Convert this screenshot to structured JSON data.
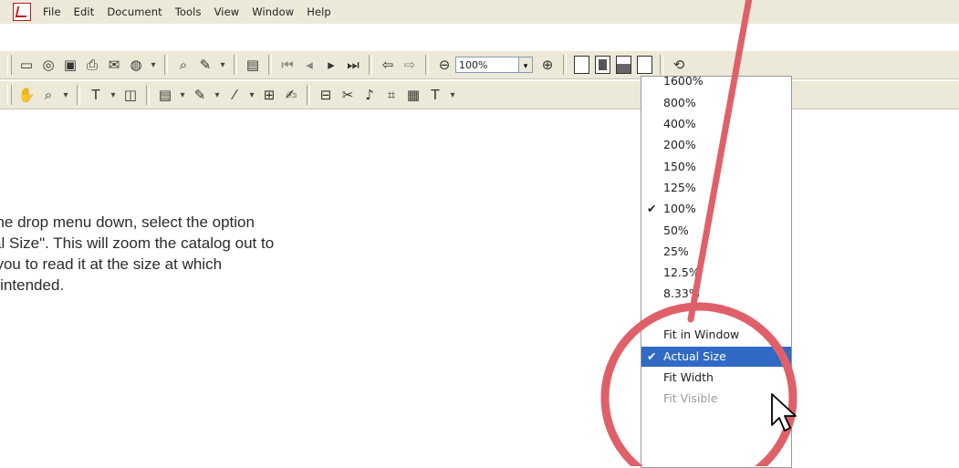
{
  "menubar": {
    "items": [
      "File",
      "Edit",
      "Document",
      "Tools",
      "View",
      "Window",
      "Help"
    ]
  },
  "toolbar": {
    "zoom_value": "100%"
  },
  "instruction": {
    "lines": [
      "With the drop menu down, select the option",
      "\"Actual Size\". This will zoom the catalog out to",
      "allow you to read it at the size at which",
      "it was intended."
    ]
  },
  "zoom_menu": {
    "items": [
      {
        "label": "1600%",
        "checked": false
      },
      {
        "label": "800%",
        "checked": false
      },
      {
        "label": "400%",
        "checked": false
      },
      {
        "label": "200%",
        "checked": false
      },
      {
        "label": "150%",
        "checked": false
      },
      {
        "label": "125%",
        "checked": false
      },
      {
        "label": "100%",
        "checked": true
      },
      {
        "label": "50%",
        "checked": false
      },
      {
        "label": "25%",
        "checked": false
      },
      {
        "label": "12.5%",
        "checked": false
      },
      {
        "label": "8.33%",
        "checked": false
      },
      {
        "label": "Fit in Window",
        "checked": false
      },
      {
        "label": "Actual Size",
        "checked": true,
        "highlighted": true
      },
      {
        "label": "Fit Width",
        "checked": false
      },
      {
        "label": "Fit Visible",
        "checked": false,
        "disabled": true
      }
    ]
  },
  "icons": [
    "pdf-app-icon",
    "open-icon",
    "print-icon",
    "save-icon",
    "hand-icon",
    "zoom-in-icon",
    "checkmark-icon",
    "pointer-cursor-icon"
  ],
  "colors": {
    "annotation": "#e0606a",
    "highlight": "#316ac5",
    "toolbar": "#ece9d8"
  }
}
